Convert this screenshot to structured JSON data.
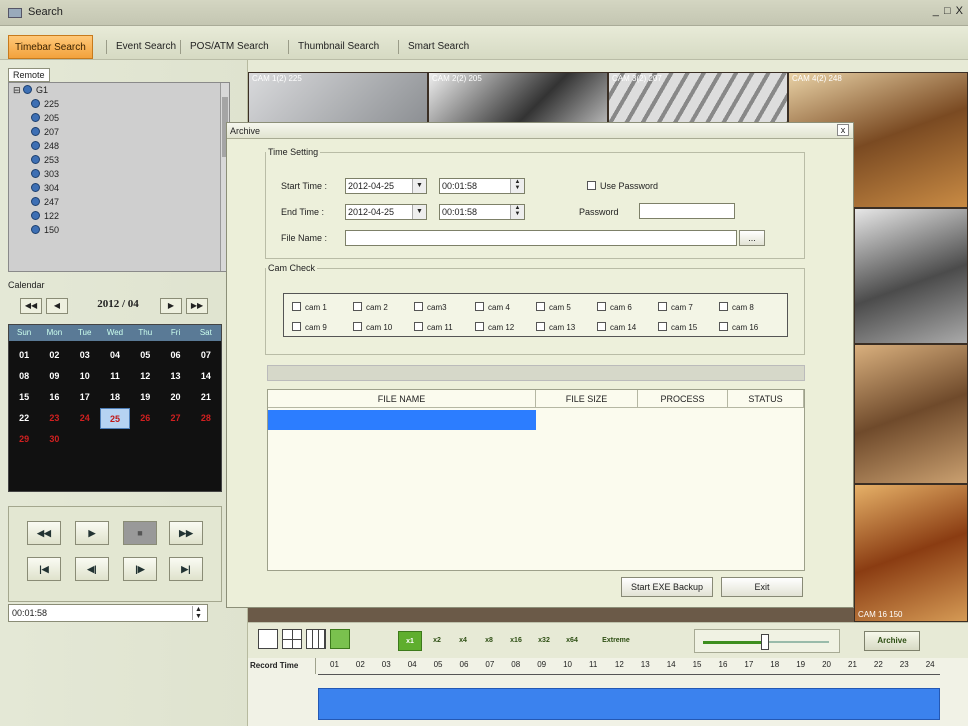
{
  "window": {
    "title": "Search",
    "controls": "_ □ X"
  },
  "tabs": [
    {
      "label": "Timebar Search",
      "active": true
    },
    {
      "label": "Event Search"
    },
    {
      "label": "POS/ATM Search"
    },
    {
      "label": "Thumbnail Search"
    },
    {
      "label": "Smart Search"
    }
  ],
  "left": {
    "remote_tab": "Remote",
    "tree": {
      "root": "G1",
      "items": [
        "225",
        "205",
        "207",
        "248",
        "253",
        "303",
        "304",
        "247",
        "122",
        "150"
      ]
    },
    "calendar": {
      "label": "Calendar",
      "month": "2012 / 04",
      "nav": {
        "prev_year": "◀◀",
        "prev": "◀",
        "next": "▶",
        "next_year": "▶▶"
      },
      "weekdays": [
        "Sun",
        "Mon",
        "Tue",
        "Wed",
        "Thu",
        "Fri",
        "Sat"
      ],
      "days": [
        "01",
        "02",
        "03",
        "04",
        "05",
        "06",
        "07",
        "08",
        "09",
        "10",
        "11",
        "12",
        "13",
        "14",
        "15",
        "16",
        "17",
        "18",
        "19",
        "20",
        "21",
        "22",
        "23",
        "24",
        "25",
        "26",
        "27",
        "28",
        "29",
        "30"
      ],
      "selected_day": "25",
      "red_from": "23"
    },
    "playback": {
      "row1": [
        "◀◀",
        "▶",
        "■",
        "▶▶"
      ],
      "row2": [
        "|◀",
        "◀|",
        "|▶",
        "▶|"
      ]
    },
    "time_value": "00:01:58"
  },
  "video": {
    "labels": [
      "CAM 1(2) 225",
      "CAM 2(2) 205",
      "CAM 3(2) 207",
      "CAM 4(2) 248"
    ],
    "bottom_right_label": "CAM 16 150"
  },
  "dialog": {
    "title": "Archive",
    "close": "x",
    "time_setting": {
      "legend": "Time Setting",
      "start_label": "Start Time :",
      "start_date": "2012-04-25",
      "start_time": "00:01:58",
      "end_label": "End Time :",
      "end_date": "2012-04-25",
      "end_time": "00:01:58",
      "file_label": "File Name :",
      "file_value": "",
      "browse": "...",
      "use_password": "Use Password",
      "password_label": "Password"
    },
    "cam_check": {
      "legend": "Cam Check",
      "cams": [
        "cam 1",
        "cam 2",
        "cam3",
        "cam 4",
        "cam 5",
        "cam 6",
        "cam 7",
        "cam 8",
        "cam 9",
        "cam 10",
        "cam 11",
        "cam 12",
        "cam 13",
        "cam 14",
        "cam 15",
        "cam 16"
      ]
    },
    "table": {
      "columns": [
        "FILE NAME",
        "FILE SIZE",
        "PROCESS",
        "STATUS"
      ]
    },
    "buttons": {
      "start": "Start EXE Backup",
      "exit": "Exit"
    }
  },
  "toolbar": {
    "speeds": [
      "x1",
      "x2",
      "x4",
      "x8",
      "x16",
      "x32",
      "x64",
      "Extreme"
    ],
    "active_speed": "x1",
    "archive": "Archive"
  },
  "timeline": {
    "label": "Record Time",
    "hours": [
      "01",
      "02",
      "03",
      "04",
      "05",
      "06",
      "07",
      "08",
      "09",
      "10",
      "11",
      "12",
      "13",
      "14",
      "15",
      "16",
      "17",
      "18",
      "19",
      "20",
      "21",
      "22",
      "23",
      "24"
    ]
  },
  "colors": {
    "accent_tab": "#f3a23c",
    "record_bar": "#3b82ee",
    "selection": "#2c7dff"
  }
}
